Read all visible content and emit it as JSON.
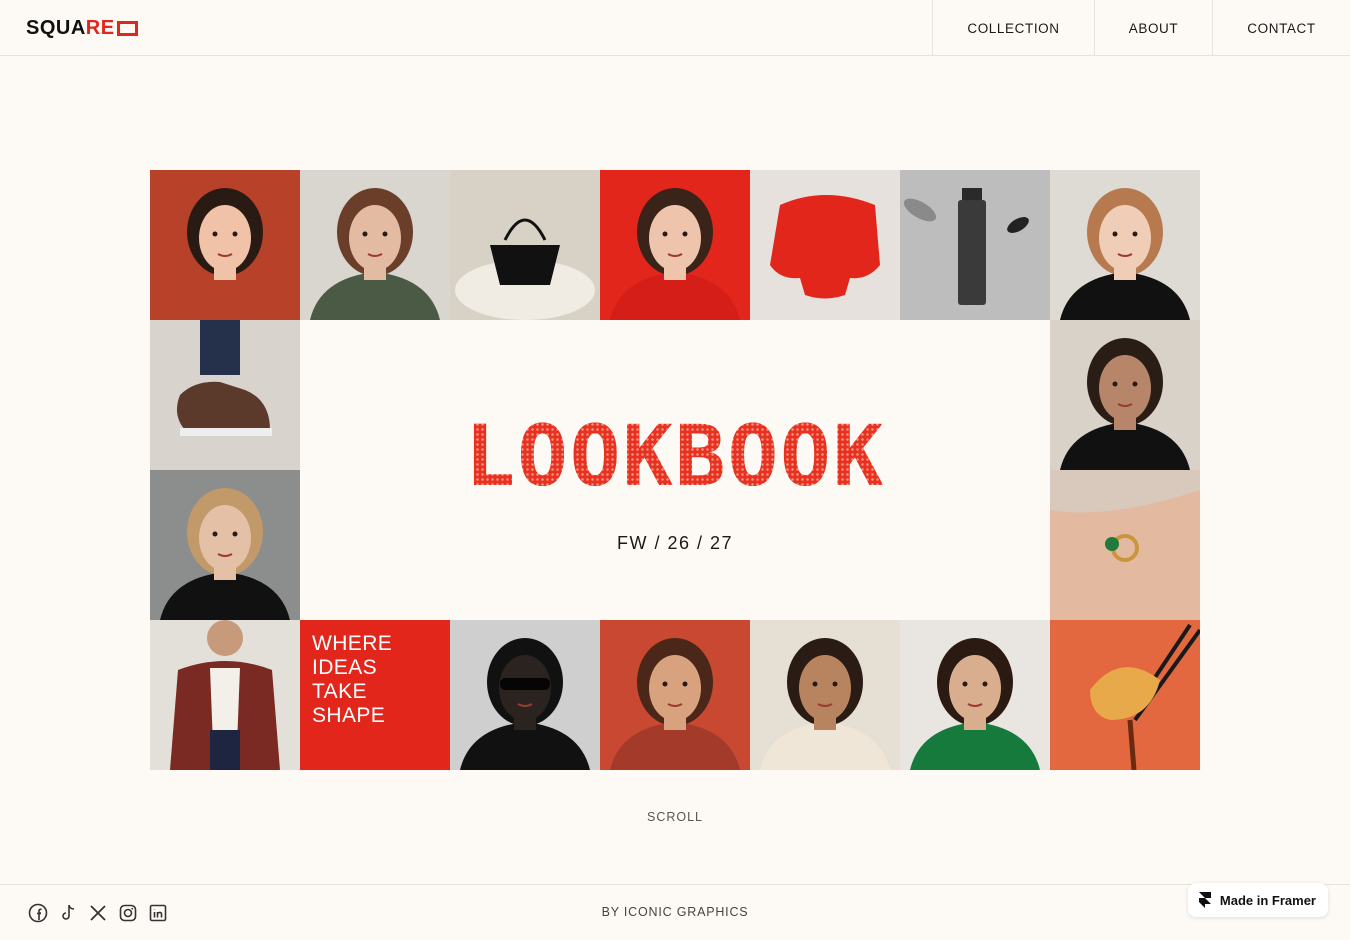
{
  "brand": {
    "logo_dark": "SQUA",
    "logo_red": "RE",
    "logo_alt": "SQUARED"
  },
  "nav": {
    "items": [
      "COLLECTION",
      "ABOUT",
      "CONTACT"
    ]
  },
  "hero": {
    "title": "LOOKBOOK",
    "season": "FW / 26 / 27",
    "tagline": [
      "WHERE",
      "IDEAS",
      "TAKE",
      "SHAPE"
    ]
  },
  "scroll_label": "SCROLL",
  "footer": {
    "byline": "BY ICONIC GRAPHICS",
    "socials": [
      "facebook-icon",
      "tiktok-icon",
      "x-icon",
      "instagram-icon",
      "linkedin-icon"
    ],
    "framer_badge": "Made in Framer"
  },
  "tiles": [
    {
      "name": "tile-woman-portrait-rust",
      "bg": "#b8412a",
      "fg": "#f0c2a8",
      "hair": "#2a1a14"
    },
    {
      "name": "tile-woman-green-coat",
      "bg": "#d9d6cf",
      "fg": "#e2bba2",
      "hair": "#6a3e28"
    },
    {
      "name": "tile-black-handbag",
      "bg": "#d8d1c6",
      "fg": "#111111",
      "hair": "#f0ece4"
    },
    {
      "name": "tile-woman-red-turtleneck",
      "bg": "#e3261c",
      "fg": "#efc4ad",
      "hair": "#3a2318"
    },
    {
      "name": "tile-red-sweater",
      "bg": "#e6e1dc",
      "fg": "#e3261c",
      "hair": "#e3261c"
    },
    {
      "name": "tile-perfume-bottle",
      "bg": "#bdbdbd",
      "fg": "#3a3a3a",
      "hair": "#222222"
    },
    {
      "name": "tile-woman-black-blazer",
      "bg": "#dedad4",
      "fg": "#efcdb6",
      "hair": "#b77a4f"
    },
    {
      "name": "tile-floating-sneaker",
      "bg": "#d8d3cc",
      "fg": "#5b3a2c",
      "hair": "#25304a"
    },
    {
      "name": "tile-woman-black-collar",
      "bg": "#d8d2c9",
      "fg": "#b7866a",
      "hair": "#2a1d16"
    },
    {
      "name": "tile-man-black-coat",
      "bg": "#8c8e8d",
      "fg": "#e3c0a6",
      "hair": "#c29a6a"
    },
    {
      "name": "tile-hand-ring",
      "bg": "#d8c9bc",
      "fg": "#e3b99f",
      "hair": "#1f7a3b"
    },
    {
      "name": "tile-man-brocade-jacket",
      "bg": "#e3dfd9",
      "fg": "#7a2a22",
      "hair": "#c79a7c"
    },
    {
      "name": "tile-tagline-red",
      "bg": "#e3261c",
      "fg": "#e3261c",
      "hair": "#e3261c"
    },
    {
      "name": "tile-man-sunglasses",
      "bg": "#cfcfcf",
      "fg": "#2a2320",
      "hair": "#111111"
    },
    {
      "name": "tile-man-curly-rust",
      "bg": "#c84832",
      "fg": "#d9a27f",
      "hair": "#4a2718"
    },
    {
      "name": "tile-woman-glowing-skin",
      "bg": "#e6dfd3",
      "fg": "#b8845f",
      "hair": "#2a1c14"
    },
    {
      "name": "tile-man-green-sweater",
      "bg": "#e9e6e2",
      "fg": "#d9ae8f",
      "hair": "#2a1a12"
    },
    {
      "name": "tile-dumpling-chopsticks",
      "bg": "#e36840",
      "fg": "#e8a94a",
      "hair": "#1a1a1a"
    }
  ]
}
